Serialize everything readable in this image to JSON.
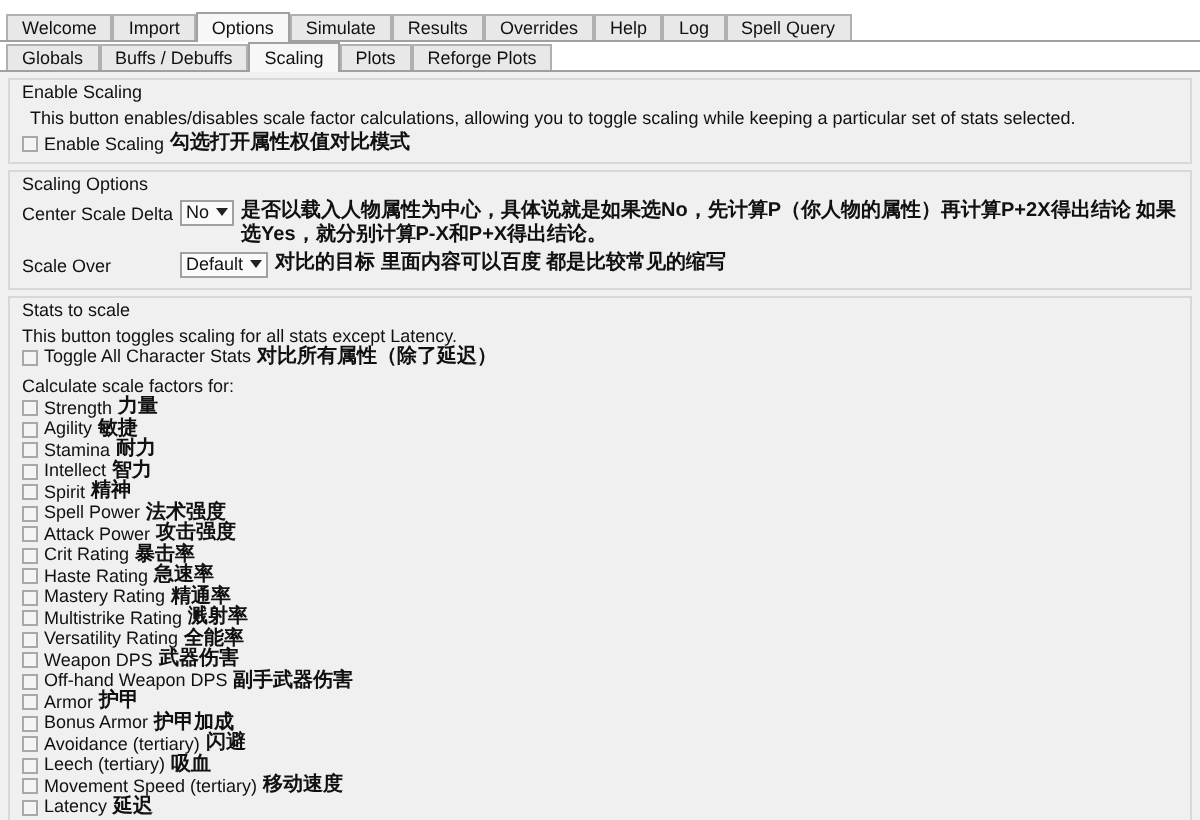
{
  "tabs": [
    {
      "label": "Welcome",
      "selected": false
    },
    {
      "label": "Import",
      "selected": false
    },
    {
      "label": "Options",
      "selected": true
    },
    {
      "label": "Simulate",
      "selected": false
    },
    {
      "label": "Results",
      "selected": false
    },
    {
      "label": "Overrides",
      "selected": false
    },
    {
      "label": "Help",
      "selected": false
    },
    {
      "label": "Log",
      "selected": false
    },
    {
      "label": "Spell Query",
      "selected": false
    }
  ],
  "subtabs": [
    {
      "label": "Globals",
      "selected": false
    },
    {
      "label": "Buffs / Debuffs",
      "selected": false
    },
    {
      "label": "Scaling",
      "selected": true
    },
    {
      "label": "Plots",
      "selected": false
    },
    {
      "label": "Reforge Plots",
      "selected": false
    }
  ],
  "enable_scaling": {
    "title": "Enable Scaling",
    "description": "This button enables/disables scale factor calculations, allowing you to toggle scaling while keeping a particular set of stats selected.",
    "checkbox": {
      "label": "Enable Scaling",
      "note": "勾选打开属性权值对比模式",
      "checked": false
    }
  },
  "scaling_options": {
    "title": "Scaling Options",
    "fields": [
      {
        "label": "Center Scale Delta",
        "value": "No",
        "note": "是否以载入人物属性为中心，具体说就是如果选No，先计算P（你人物的属性）再计算P+2X得出结论 如果选Yes，就分别计算P-X和P+X得出结论。"
      },
      {
        "label": "Scale Over",
        "value": "Default",
        "note": "对比的目标 里面内容可以百度 都是比较常见的缩写"
      }
    ]
  },
  "stats_to_scale": {
    "title": "Stats to scale",
    "description": "This button toggles scaling for all stats except Latency.",
    "toggle": {
      "label": "Toggle All Character Stats",
      "note": "对比所有属性（除了延迟）",
      "checked": false
    },
    "list_label": "Calculate scale factors for:",
    "stats": [
      {
        "label": "Strength",
        "note": "力量",
        "checked": false
      },
      {
        "label": "Agility",
        "note": "敏捷",
        "checked": false
      },
      {
        "label": "Stamina",
        "note": "耐力",
        "checked": false
      },
      {
        "label": "Intellect",
        "note": "智力",
        "checked": false
      },
      {
        "label": "Spirit",
        "note": "精神",
        "checked": false
      },
      {
        "label": "Spell Power",
        "note": "法术强度",
        "checked": false
      },
      {
        "label": "Attack Power",
        "note": "攻击强度",
        "checked": false
      },
      {
        "label": "Crit Rating",
        "note": "暴击率",
        "checked": false
      },
      {
        "label": "Haste Rating",
        "note": "急速率",
        "checked": false
      },
      {
        "label": "Mastery Rating",
        "note": "精通率",
        "checked": false
      },
      {
        "label": "Multistrike Rating",
        "note": "溅射率",
        "checked": false
      },
      {
        "label": "Versatility Rating",
        "note": "全能率",
        "checked": false
      },
      {
        "label": "Weapon DPS",
        "note": "武器伤害",
        "checked": false
      },
      {
        "label": "Off-hand Weapon DPS",
        "note": "副手武器伤害",
        "checked": false
      },
      {
        "label": "Armor",
        "note": "护甲",
        "checked": false
      },
      {
        "label": "Bonus Armor",
        "note": "护甲加成",
        "checked": false
      },
      {
        "label": "Avoidance (tertiary)",
        "note": "闪避",
        "checked": false
      },
      {
        "label": "Leech (tertiary)",
        "note": "吸血",
        "checked": false
      },
      {
        "label": "Movement Speed (tertiary)",
        "note": "移动速度",
        "checked": false
      },
      {
        "label": "Latency",
        "note": "延迟",
        "checked": false
      }
    ]
  }
}
